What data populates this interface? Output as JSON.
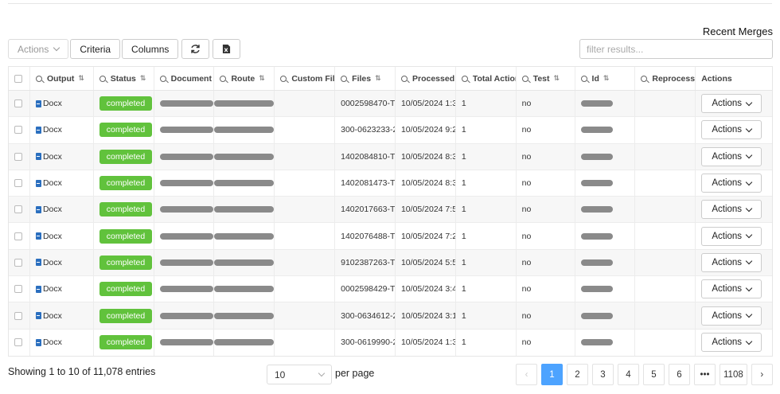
{
  "page": {
    "title": "Recent Merges"
  },
  "toolbar": {
    "actions_label": "Actions",
    "criteria_label": "Criteria",
    "columns_label": "Columns",
    "refresh_icon": "refresh-icon",
    "export_icon": "excel-export-icon"
  },
  "filter": {
    "placeholder": "filter results..."
  },
  "table": {
    "headers": {
      "output": "Output",
      "status": "Status",
      "document": "Document",
      "route": "Route",
      "custom": "Custom Fil",
      "files": "Files",
      "processed": "Processed",
      "total_actions": "Total Action",
      "test": "Test",
      "id": "Id",
      "reprocess": "Reprocesse",
      "actions": "Actions"
    },
    "rows": [
      {
        "output": "Docx",
        "status": "completed",
        "files": "0002598470-T",
        "processed": "10/05/2024 1:3",
        "total": "1",
        "test": "no",
        "action": "Actions"
      },
      {
        "output": "Docx",
        "status": "completed",
        "files": "300-0623233-2",
        "processed": "10/05/2024 9:2",
        "total": "1",
        "test": "no",
        "action": "Actions"
      },
      {
        "output": "Docx",
        "status": "completed",
        "files": "1402084810-T",
        "processed": "10/05/2024 8:3",
        "total": "1",
        "test": "no",
        "action": "Actions"
      },
      {
        "output": "Docx",
        "status": "completed",
        "files": "1402081473-T",
        "processed": "10/05/2024 8:3",
        "total": "1",
        "test": "no",
        "action": "Actions"
      },
      {
        "output": "Docx",
        "status": "completed",
        "files": "1402017663-T",
        "processed": "10/05/2024 7:5",
        "total": "1",
        "test": "no",
        "action": "Actions"
      },
      {
        "output": "Docx",
        "status": "completed",
        "files": "1402076488-T",
        "processed": "10/05/2024 7:2",
        "total": "1",
        "test": "no",
        "action": "Actions"
      },
      {
        "output": "Docx",
        "status": "completed",
        "files": "9102387263-T",
        "processed": "10/05/2024 5:5",
        "total": "1",
        "test": "no",
        "action": "Actions"
      },
      {
        "output": "Docx",
        "status": "completed",
        "files": "0002598429-T",
        "processed": "10/05/2024 3:4",
        "total": "1",
        "test": "no",
        "action": "Actions"
      },
      {
        "output": "Docx",
        "status": "completed",
        "files": "300-0634612-2",
        "processed": "10/05/2024 3:1",
        "total": "1",
        "test": "no",
        "action": "Actions"
      },
      {
        "output": "Docx",
        "status": "completed",
        "files": "300-0619990-2",
        "processed": "10/05/2024 1:3",
        "total": "1",
        "test": "no",
        "action": "Actions"
      }
    ]
  },
  "footer": {
    "entries_text": "Showing 1 to 10 of 11,078 entries",
    "per_page_value": "10",
    "per_page_label": "per page"
  },
  "pagination": {
    "prev": "‹",
    "pages": [
      "1",
      "2",
      "3",
      "4",
      "5",
      "6"
    ],
    "ellipsis": "•••",
    "last": "1108",
    "next": "›",
    "current": "1"
  },
  "colors": {
    "accent": "#4da3ff",
    "status_completed": "#61c23c",
    "doc_icon": "#2b6fbf"
  }
}
